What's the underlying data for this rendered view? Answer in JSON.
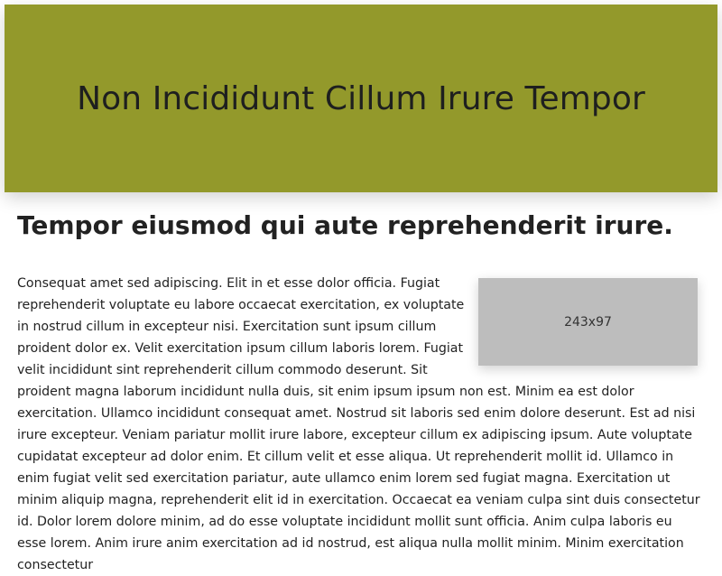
{
  "hero": {
    "title": "Non Incididunt Cillum Irure Tempor",
    "background_color": "#93992b"
  },
  "section": {
    "heading": "Tempor eiusmod qui aute reprehenderit irure."
  },
  "image_placeholder": {
    "label": "243x97"
  },
  "article": {
    "text": "Consequat amet sed adipiscing. Elit in et esse dolor officia. Fugiat reprehenderit voluptate eu labore occaecat exercitation, ex voluptate in nostrud cillum in excepteur nisi. Exercitation sunt ipsum cillum proident dolor ex. Velit exercitation ipsum cillum laboris lorem. Fugiat velit incididunt sint reprehenderit cillum commodo deserunt. Sit proident magna laborum incididunt nulla duis, sit enim ipsum ipsum non est. Minim ea est dolor exercitation. Ullamco incididunt consequat amet. Nostrud sit laboris sed enim dolore deserunt. Est ad nisi irure excepteur. Veniam pariatur mollit irure labore, excepteur cillum ex adipiscing ipsum. Aute voluptate cupidatat excepteur ad dolor enim. Et cillum velit et esse aliqua. Ut reprehenderit mollit id. Ullamco in enim fugiat velit sed exercitation pariatur, aute ullamco enim lorem sed fugiat magna. Exercitation ut minim aliquip magna, reprehenderit elit id in exercitation. Occaecat ea veniam culpa sint duis consectetur id. Dolor lorem dolore minim, ad do esse voluptate incididunt mollit sunt officia. Anim culpa laboris eu esse lorem. Anim irure anim exercitation ad id nostrud, est aliqua nulla mollit minim. Minim exercitation consectetur"
  }
}
